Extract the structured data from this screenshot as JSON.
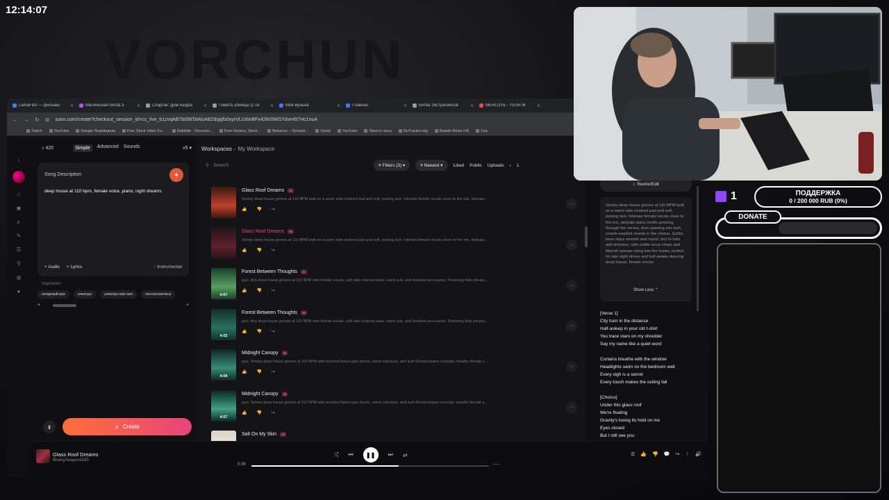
{
  "clock": "12:14:07",
  "background_text": "VORCHUN",
  "tabs": [
    {
      "title": "LamaFilm — фильмы",
      "color": "#3b82f6"
    },
    {
      "title": "Магическая битва 3",
      "color": "#a855f7"
    },
    {
      "title": "Спартак: Дом Ашура",
      "color": "#999999"
    },
    {
      "title": "Память убийцы (1 се",
      "color": "#999999"
    },
    {
      "title": "Моя музыка",
      "color": "#4f6ef7"
    },
    {
      "title": "Главная",
      "color": "#4f6ef7"
    },
    {
      "title": "Битва Экстрасенсов",
      "color": "#999999"
    },
    {
      "title": "МЕНLOVE - YEAR M",
      "color": "#ef4444"
    }
  ],
  "address": "suno.com/create?checkout_session_id=cs_live_b1zvqAB7bt39iTaWzABZdsjqfs0xyrVLUdmBFx42kh5WS7dve457Hc1nuA",
  "bookmarks": [
    "Twitch",
    "YouTube",
    "Google Переводчик",
    "Free Stock Video Fo...",
    "Dribbble - Discover...",
    "Free Vectors, Stock...",
    "Behance :: Лучшее...",
    "Gmail",
    "YouTube",
    "Просто часы",
    "RuTracker.org",
    "Raadio Relax FM",
    "Ска"
  ],
  "create": {
    "credits": "420",
    "mode_simple": "Simple",
    "mode_advanced": "Advanced",
    "mode_sounds": "Sounds",
    "version": "v5",
    "desc_label": "Song Description",
    "desc_value": "deep house at 110 bpm, female voice, piano, night dreams",
    "audio": "Audio",
    "lyrics": "Lyrics",
    "instrumental": "Instrumental",
    "inspiration_label": "Inspiration",
    "chips": [
      "гитарный рок",
      "электро",
      "электро-хип-хоп",
      "пентатоническ"
    ],
    "create_label": "Create"
  },
  "workspace": {
    "crumb_root": "Workspaces",
    "crumb_current": "My Workspace",
    "search_placeholder": "Search",
    "filters": "Filters (3)",
    "sort": "Newest",
    "liked": "Liked",
    "public": "Public",
    "uploads": "Uploads",
    "page": "1",
    "songs": [
      {
        "title": "Glass Roof Dreams",
        "tag": "v5",
        "desc": "Smoky deep house groove at 110 BPM built on a warm side-chained pad and soft, pulsing kick. Intimate female vocals close to the mic, delicate...",
        "duration": "",
        "active": false,
        "colors": [
          "#3a1a14",
          "#c0402a"
        ]
      },
      {
        "title": "Glass Roof Dreams",
        "tag": "v5",
        "desc": "Smoky deep house groove at 110 BPM built on a warm side-chained pad and soft, pulsing kick. Intimate female vocals close to the mic, delicate...",
        "duration": "",
        "active": true,
        "colors": [
          "#241418",
          "#602030"
        ]
      },
      {
        "title": "Forest Between Thoughts",
        "tag": "v5",
        "desc": "jazz. Airy deep house groove at 110 BPM with female vocals, soft side-chained pads, warm sub, and brushed percussion. Fluttering flute phrase...",
        "duration": "4:07",
        "active": false,
        "colors": [
          "#16402a",
          "#5aa060"
        ]
      },
      {
        "title": "Forest Between Thoughts",
        "tag": "v5",
        "desc": "jazz. Airy deep house groove at 110 BPM with female vocals, soft side-chained pads, warm sub, and brushed percussion. Fluttering flute phrase...",
        "duration": "4:02",
        "active": false,
        "colors": [
          "#10302a",
          "#2a7060"
        ]
      },
      {
        "title": "Midnight Canopy",
        "tag": "v5",
        "desc": "jazz. Smoky deep house groove at 110 BPM with brushed future-jazz drums, warm sub bass, and lush Rhodes/piano voicings; breathy female v...",
        "duration": "4:04",
        "active": false,
        "colors": [
          "#0e2a28",
          "#3a8a78"
        ]
      },
      {
        "title": "Midnight Canopy",
        "tag": "v5",
        "desc": "jazz. Smoky deep house groove at 110 BPM with brushed future-jazz drums, warm sub bass, and lush Rhodes/piano voicings; breathy female v...",
        "duration": "4:57",
        "active": false,
        "colors": [
          "#0c2624",
          "#40a088"
        ]
      },
      {
        "title": "Salt On My Skin",
        "tag": "v5",
        "desc": "",
        "duration": "",
        "active": false,
        "colors": [
          "#d8d2c8",
          "#f2eee6"
        ]
      }
    ]
  },
  "player": {
    "title": "Glass Roof Dreams",
    "artist": "BluesySeapunk530",
    "time": "0:36",
    "end_time": "--:--",
    "progress": 0.62
  },
  "side": {
    "remix": "Remix/Edit",
    "description": "Smoky deep house groove at 110 BPM built on a warm side-chained pad and soft, pulsing kick. Intimate female vocals close to the mic, delicate piano motifs weaving through the verses, then opening into lush, reverb-washed chords in the chorus. Subby bass stays smooth and round, airy hi-hats add shimmer, with subtle vocal chops and filtered sweeps rising into the hooks, perfect for late-night drives and half-awake dancing. deep house, female vocals",
    "show_less": "Show Less",
    "lyrics": "[Verse 1]\nCity hum in the distance\nHalf-asleep in your old t-shirt\nYou trace stars on my shoulder\nSay my name like a quiet word\n\nCurtains breathe with the window\nHeadlights swim on the bedroom wall\nEvery sigh is a secret\nEvery touch makes the ceiling fall\n\n[Chorus]\nUnder this glass roof\nWe're floating\nGravity's losing its hold on me\nEyes closed\nBut I still see you"
  },
  "stream": {
    "followers": "1",
    "support_title": "ПОДДЕРЖКА",
    "support_progress": "0 / 200 000 RUB (0%)",
    "donate": "DONATE"
  }
}
